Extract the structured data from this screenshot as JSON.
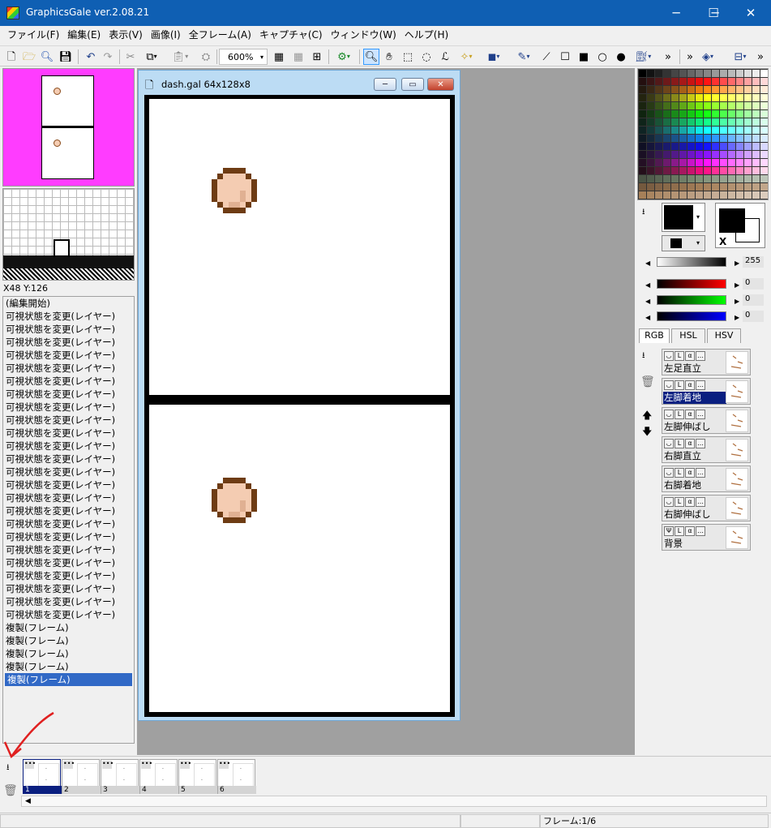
{
  "app": {
    "title": "GraphicsGale ver.2.08.21"
  },
  "window_controls": {
    "minimize": "─",
    "maximize": "☐",
    "close": "✕"
  },
  "menu": [
    "ファイル(F)",
    "編集(E)",
    "表示(V)",
    "画像(I)",
    "全フレーム(A)",
    "キャプチャ(C)",
    "ウィンドウ(W)",
    "ヘルプ(H)"
  ],
  "toolbar": {
    "zoom": "600%",
    "icons": [
      "new-file-icon",
      "open-folder-icon",
      "magnifier-icon",
      "save-icon",
      "undo-icon",
      "redo-icon",
      "cut-icon",
      "copy-icon",
      "paste-icon",
      "stamp-icon",
      "grid-icon",
      "grid-fine-icon",
      "grid-select-icon",
      "gear-icon",
      "zoom-tool-icon",
      "hand-tool-icon",
      "rect-select-icon",
      "lasso-icon",
      "lasso-fill-icon",
      "magic-wand-icon",
      "brush-icon",
      "eyedropper-icon",
      "line-icon",
      "rect-icon",
      "filled-rect-icon",
      "ellipse-icon",
      "filled-ellipse-icon",
      "paint-bucket-icon",
      "move-icon",
      "transform-icon"
    ]
  },
  "left_panel": {
    "coordinates": "X48 Y:126",
    "history": [
      "(編集開始)",
      "可視状態を変更(レイヤー)",
      "可視状態を変更(レイヤー)",
      "可視状態を変更(レイヤー)",
      "可視状態を変更(レイヤー)",
      "可視状態を変更(レイヤー)",
      "可視状態を変更(レイヤー)",
      "可視状態を変更(レイヤー)",
      "可視状態を変更(レイヤー)",
      "可視状態を変更(レイヤー)",
      "可視状態を変更(レイヤー)",
      "可視状態を変更(レイヤー)",
      "可視状態を変更(レイヤー)",
      "可視状態を変更(レイヤー)",
      "可視状態を変更(レイヤー)",
      "可視状態を変更(レイヤー)",
      "可視状態を変更(レイヤー)",
      "可視状態を変更(レイヤー)",
      "可視状態を変更(レイヤー)",
      "可視状態を変更(レイヤー)",
      "可視状態を変更(レイヤー)",
      "可視状態を変更(レイヤー)",
      "可視状態を変更(レイヤー)",
      "可視状態を変更(レイヤー)",
      "可視状態を変更(レイヤー)",
      "複製(フレーム)",
      "複製(フレーム)",
      "複製(フレーム)",
      "複製(フレーム)",
      "複製(フレーム)"
    ],
    "selected_history_index": 29
  },
  "document": {
    "title": "dash.gal 64x128x8",
    "minimize": "─",
    "restore": "▭",
    "close": "✕"
  },
  "colors": {
    "preview_bg": "#ff3cff",
    "ball_fill": "#f4ccb2",
    "ball_outline": "#6e3c14",
    "selected": "#0a1f80"
  },
  "color_panel": {
    "brightness": "255",
    "r": "0",
    "g": "0",
    "b": "0",
    "tabs": [
      "RGB",
      "HSL",
      "HSV"
    ],
    "x_label": "X"
  },
  "layers": [
    {
      "name": "左足直立",
      "selected": false
    },
    {
      "name": "左脚着地",
      "selected": true
    },
    {
      "name": "左脚伸ばし",
      "selected": false
    },
    {
      "name": "右脚直立",
      "selected": false
    },
    {
      "name": "右脚着地",
      "selected": false
    },
    {
      "name": "右脚伸ばし",
      "selected": false
    },
    {
      "name": "背景",
      "selected": false
    }
  ],
  "frames": [
    "1",
    "2",
    "3",
    "4",
    "5",
    "6"
  ],
  "selected_frame": "1",
  "status": {
    "frame": "フレーム:1/6"
  }
}
